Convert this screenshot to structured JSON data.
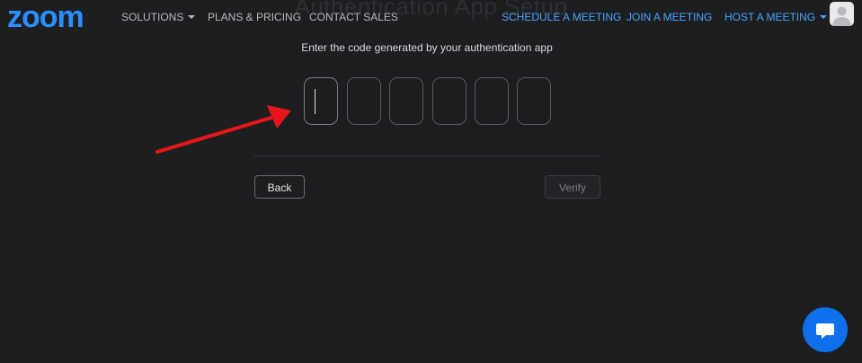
{
  "ghost_heading": "Authentication App Setup",
  "nav": {
    "logo": "zoom",
    "left_links": [
      "SOLUTIONS",
      "PLANS & PRICING",
      "CONTACT SALES"
    ],
    "right_links": [
      "SCHEDULE A MEETING",
      "JOIN A MEETING",
      "HOST A MEETING"
    ]
  },
  "auth": {
    "prompt": "Enter the code generated by your authentication app",
    "digit_count": 6,
    "digits": [
      "",
      "",
      "",
      "",
      "",
      ""
    ]
  },
  "buttons": {
    "back": "Back",
    "verify": "Verify"
  },
  "colors": {
    "background": "#1d1e20",
    "brand_blue": "#2d8cff",
    "annotation_red": "#e8161b"
  },
  "icons": {
    "chat": "chat-bubble-icon",
    "avatar": "user-avatar-icon",
    "annotation": "red-arrow-annotation"
  }
}
